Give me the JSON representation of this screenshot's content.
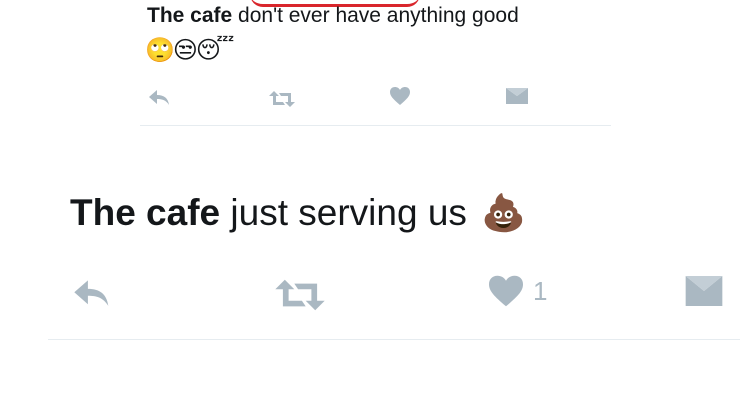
{
  "tweets": [
    {
      "bold": "The cafe",
      "text": " don't ever have anything good",
      "emoji": "🙄😒😴",
      "actions": {
        "reply": "reply-icon",
        "retweet": "retweet-icon",
        "like": "heart-icon",
        "dm": "envelope-icon"
      },
      "like_count": ""
    },
    {
      "bold": "The cafe",
      "text": " just serving us ",
      "emoji": "💩",
      "actions": {
        "reply": "reply-icon",
        "retweet": "retweet-icon",
        "like": "heart-icon",
        "dm": "envelope-icon"
      },
      "like_count": "1"
    }
  ],
  "colors": {
    "icon": "#aab8c2",
    "text": "#14171a",
    "divider": "#e6ecf0",
    "annotation": "#d9262c"
  }
}
